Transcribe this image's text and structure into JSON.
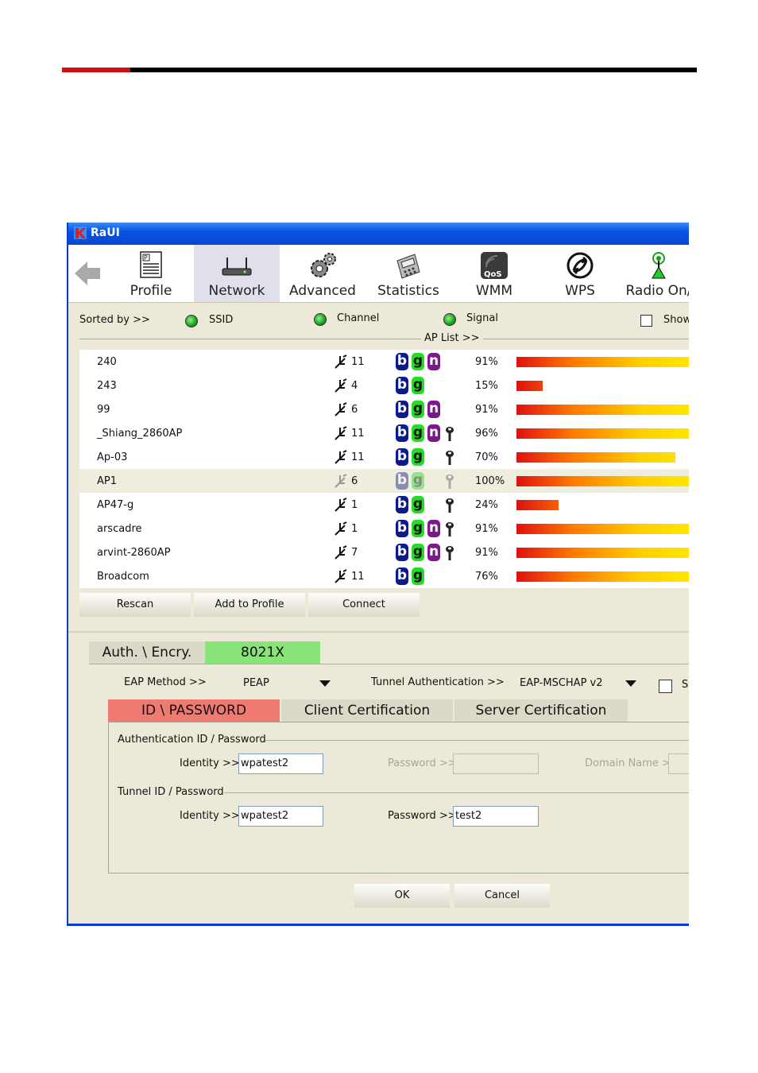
{
  "window": {
    "title": "RaUI"
  },
  "toolbar": {
    "items": [
      {
        "label": "Profile",
        "icon": "profile-icon"
      },
      {
        "label": "Network",
        "icon": "network-icon"
      },
      {
        "label": "Advanced",
        "icon": "gear-icon"
      },
      {
        "label": "Statistics",
        "icon": "statistics-icon"
      },
      {
        "label": "WMM",
        "icon": "qos-icon"
      },
      {
        "label": "WPS",
        "icon": "wps-icon"
      },
      {
        "label": "Radio On/",
        "icon": "radio-antenna-icon"
      }
    ],
    "selected": "Network"
  },
  "sort": {
    "label": "Sorted by >>",
    "options": [
      "SSID",
      "Channel",
      "Signal"
    ],
    "show_label": "Show"
  },
  "ap_list": {
    "label": "AP List >>",
    "rows": [
      {
        "ssid": "240",
        "channel": "11",
        "modes": [
          "b",
          "g",
          "n"
        ],
        "secured": false,
        "signal": "91%",
        "signal_value": 91
      },
      {
        "ssid": "243",
        "channel": "4",
        "modes": [
          "b",
          "g"
        ],
        "secured": false,
        "signal": "15%",
        "signal_value": 15
      },
      {
        "ssid": "99",
        "channel": "6",
        "modes": [
          "b",
          "g",
          "n"
        ],
        "secured": false,
        "signal": "91%",
        "signal_value": 91
      },
      {
        "ssid": "_Shiang_2860AP",
        "channel": "11",
        "modes": [
          "b",
          "g",
          "n"
        ],
        "secured": true,
        "signal": "96%",
        "signal_value": 96
      },
      {
        "ssid": "Ap-03",
        "channel": "11",
        "modes": [
          "b",
          "g"
        ],
        "secured": true,
        "signal": "70%",
        "signal_value": 70
      },
      {
        "ssid": "AP1",
        "channel": "6",
        "modes": [
          "b",
          "g"
        ],
        "secured": true,
        "signal": "100%",
        "signal_value": 100,
        "selected": true
      },
      {
        "ssid": "AP47-g",
        "channel": "1",
        "modes": [
          "b",
          "g"
        ],
        "secured": true,
        "signal": "24%",
        "signal_value": 24
      },
      {
        "ssid": "arscadre",
        "channel": "1",
        "modes": [
          "b",
          "g",
          "n"
        ],
        "secured": true,
        "signal": "91%",
        "signal_value": 91
      },
      {
        "ssid": "arvint-2860AP",
        "channel": "7",
        "modes": [
          "b",
          "g",
          "n"
        ],
        "secured": true,
        "signal": "91%",
        "signal_value": 91
      },
      {
        "ssid": "Broadcom",
        "channel": "11",
        "modes": [
          "b",
          "g"
        ],
        "secured": false,
        "signal": "76%",
        "signal_value": 76
      }
    ]
  },
  "buttons": {
    "rescan": "Rescan",
    "add_to_profile": "Add to Profile",
    "connect": "Connect",
    "ok": "OK",
    "cancel": "Cancel"
  },
  "auth_tabs": {
    "auth": "Auth. \\ Encry.",
    "x8021": "8021X"
  },
  "eap": {
    "method_label": "EAP Method >>",
    "method_value": "PEAP",
    "tunnel_label": "Tunnel Authentication >>",
    "tunnel_value": "EAP-MSCHAP v2",
    "se_label": "Se"
  },
  "sub_tabs": [
    "ID \\ PASSWORD",
    "Client Certification",
    "Server Certification"
  ],
  "auth_group": {
    "title": "Authentication ID / Password",
    "identity_label": "Identity >>",
    "identity_value": "wpatest2",
    "password_label": "Password >>",
    "password_value": "",
    "domain_label": "Domain Name >>"
  },
  "tunnel_group": {
    "title": "Tunnel ID / Password",
    "identity_label": "Identity >>",
    "identity_value": "wpatest2",
    "password_label": "Password >>",
    "password_value": "test2"
  }
}
